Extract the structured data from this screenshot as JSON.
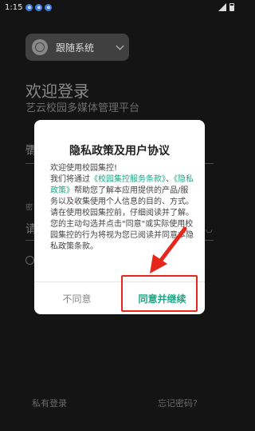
{
  "status_bar": {
    "time": "1:15",
    "notifications": [
      "e",
      "e",
      "e"
    ]
  },
  "background": {
    "language_selector": "跟随系统",
    "welcome_title": "欢迎登录",
    "subtitle": "艺云校园多媒体管理平台",
    "username_label": "用",
    "username_value": "请",
    "password_label": "密",
    "password_value": "请",
    "private_login": "私有登录",
    "forgot_password": "忘记密码?"
  },
  "dialog": {
    "title": "隐私政策及用户协议",
    "greeting": "欢迎使用校园集控!",
    "body_prefix": "我们将通过",
    "service_terms_link": "《校园集控服务条款》",
    "separator": "、",
    "privacy_policy_link": "《隐私政策》",
    "body_main": "帮助您了解本应用提供的产品/服务以及收集使用个人信息的目的、方式。请在使用校园集控前，仔细阅读并了解。您的主动勾选并点击\"同意\"或实际使用校园集控的行为将视为您已阅读并同意本隐私政策条款。",
    "disagree_label": "不同意",
    "agree_label": "同意并继续"
  },
  "colors": {
    "accent": "#1aa884",
    "annotation": "#e8271c"
  }
}
